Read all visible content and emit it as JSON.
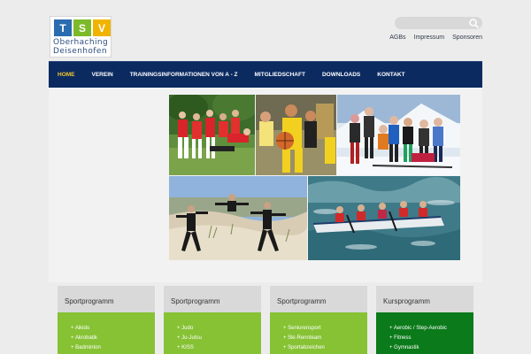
{
  "logo": {
    "tiles": [
      {
        "letter": "T",
        "color": "#2a6cb0"
      },
      {
        "letter": "S",
        "color": "#7cba29"
      },
      {
        "letter": "V",
        "color": "#f0b400"
      }
    ],
    "line1": "Oberhaching",
    "line2": "Deisenhofen"
  },
  "search": {
    "value": ""
  },
  "top_links": [
    "AGBs",
    "Impressum",
    "Sponsoren"
  ],
  "nav": {
    "items": [
      "HOME",
      "VEREIN",
      "TRAININGSINFORMATIONEN VON A - Z",
      "MITGLIEDSCHAFT",
      "DOWNLOADS",
      "KONTAKT"
    ],
    "active_index": 0
  },
  "boxes": [
    {
      "title": "Sportprogramm",
      "color": "#86c234",
      "items": [
        "Aikido",
        "Akrobatik",
        "Badminton"
      ]
    },
    {
      "title": "Sportprogramm",
      "color": "#86c234",
      "items": [
        "Judo",
        "Ju-Jutsu",
        "KISS"
      ]
    },
    {
      "title": "Sportprogramm",
      "color": "#86c234",
      "items": [
        "Seniorensport",
        "Ski-Rennteam",
        "Sportabzeichen"
      ]
    },
    {
      "title": "Kursprogramm",
      "color": "#0b7a1a",
      "items": [
        "Aerobic / Step-Aerobic",
        "Fitness",
        "Gymnastik"
      ]
    }
  ],
  "colors": {
    "nav_bg": "#0b2a60",
    "nav_active": "#f3c92b",
    "box_head": "#d9d9d9"
  }
}
